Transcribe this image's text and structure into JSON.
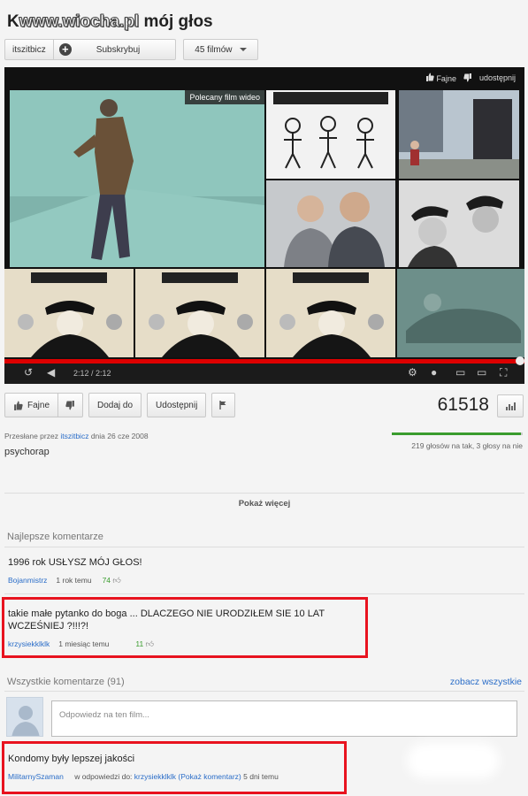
{
  "header": {
    "title_prefix": "K",
    "watermark": "www.wiocha.pl",
    "title_suffix": "mój głos"
  },
  "channel": {
    "name": "itszitbicz",
    "subscribe_label": "Subskrybuj",
    "video_count": "45 filmów"
  },
  "player": {
    "like_label": "Fajne",
    "share_label": "udostępnij",
    "recommended_label": "Polecany film wideo",
    "time": "2:12 / 2:12",
    "progress": 1.0
  },
  "actions": {
    "like": "Fajne",
    "add_to": "Dodaj do",
    "share": "Udostępnij"
  },
  "views": "61518",
  "upload": {
    "prefix": "Przesłane przez",
    "user": "itszitbicz",
    "date": "dnia 26 cze 2008"
  },
  "likes": {
    "ratio": 0.986,
    "text": "219 głosów na tak, 3 głosy na nie"
  },
  "description": "psychorap",
  "show_more": "Pokaż więcej",
  "top_comments": {
    "heading": "Najlepsze komentarze",
    "items": [
      {
        "text": "1996 rok USŁYSZ MÓJ GŁOS!",
        "user": "Bojanmistrz",
        "time": "1 rok temu",
        "score": "74"
      },
      {
        "text": "takie małe pytanko do boga ... DLACZEGO NIE URODZIŁEM SIE 10 LAT WCZEŚNIEJ ?!!!?!",
        "user": "krzysiekklklk",
        "time": "1 miesiąc temu",
        "score": "11"
      }
    ]
  },
  "all_comments": {
    "heading": "Wszystkie komentarze (91)",
    "see_all": "zobacz wszystkie",
    "reply_placeholder": "Odpowiedz na ten film...",
    "items": [
      {
        "text": "Kondomy były lepszej jakości",
        "user": "MilitarnySzaman",
        "reply_prefix": "w odpowiedzi do:",
        "reply_to": "krzysiekklklk",
        "show_comment": "(Pokaż komentarz)",
        "time": "5 dni temu"
      }
    ]
  },
  "colors": {
    "highlight": "#e8131f",
    "link": "#2a6dc8",
    "progress": "#dd0000",
    "like_green": "#3a9c2e"
  }
}
